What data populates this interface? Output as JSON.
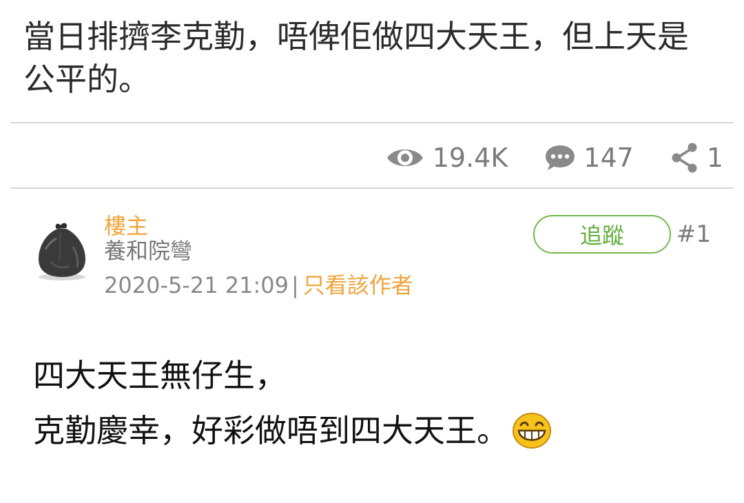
{
  "thread": {
    "title": "當日排擠李克勤，唔俾佢做四大天王，但上天是公平的。"
  },
  "stats": {
    "views": "19.4K",
    "replies": "147",
    "shares": "1",
    "views_icon": "eye-icon",
    "replies_icon": "comment-bubble-icon",
    "shares_icon": "share-icon"
  },
  "post": {
    "op_tag": "樓主",
    "author": "養和院彎",
    "datetime": "2020-5-21 21:09",
    "separator": "|",
    "only_author_link": "只看該作者",
    "follow_label": "追蹤",
    "floor": "#1",
    "avatar_icon": "garbage-bag-avatar",
    "body_lines": [
      "四大天王無仔生，",
      "克勤慶幸，好彩做唔到四大天王。"
    ],
    "emoticon": "grinning-face-icon"
  },
  "colors": {
    "accent_orange": "#f0a43a",
    "follow_green": "#72b84a",
    "stat_gray": "#7a7a7a",
    "divider": "#d6d6d6"
  }
}
